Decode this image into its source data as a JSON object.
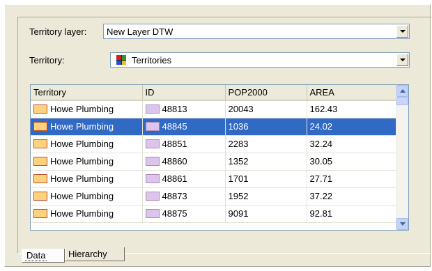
{
  "form": {
    "territory_layer_label": "Territory layer:",
    "territory_layer_value": "New Layer DTW",
    "territory_label": "Territory:",
    "territory_value": "Territories"
  },
  "grid": {
    "columns": [
      "Territory",
      "ID",
      "POP2000",
      "AREA"
    ],
    "rows": [
      {
        "territory": "Howe Plumbing",
        "id": "48813",
        "pop2000": "20043",
        "area": "162.43",
        "selected": false
      },
      {
        "territory": "Howe Plumbing",
        "id": "48845",
        "pop2000": "1036",
        "area": "24.02",
        "selected": true
      },
      {
        "territory": "Howe Plumbing",
        "id": "48851",
        "pop2000": "2283",
        "area": "32.24",
        "selected": false
      },
      {
        "territory": "Howe Plumbing",
        "id": "48860",
        "pop2000": "1352",
        "area": "30.05",
        "selected": false
      },
      {
        "territory": "Howe Plumbing",
        "id": "48861",
        "pop2000": "1701",
        "area": "27.71",
        "selected": false
      },
      {
        "territory": "Howe Plumbing",
        "id": "48873",
        "pop2000": "1952",
        "area": "37.22",
        "selected": false
      },
      {
        "territory": "Howe Plumbing",
        "id": "48875",
        "pop2000": "9091",
        "area": "92.81",
        "selected": false
      }
    ]
  },
  "tabs": [
    {
      "label": "Data",
      "active": true
    },
    {
      "label": "Hierarchy",
      "active": false
    }
  ],
  "colors": {
    "selection": "#316ac5",
    "territory_swatch": "#fcd27e",
    "id_swatch": "#dcc4ec"
  },
  "icons": {
    "territory_combo_icon": "territories-map-icon",
    "combo_dropdown": "chevron-down-icon",
    "scroll_up": "scroll-up-arrow-icon",
    "scroll_down": "scroll-down-arrow-icon"
  }
}
